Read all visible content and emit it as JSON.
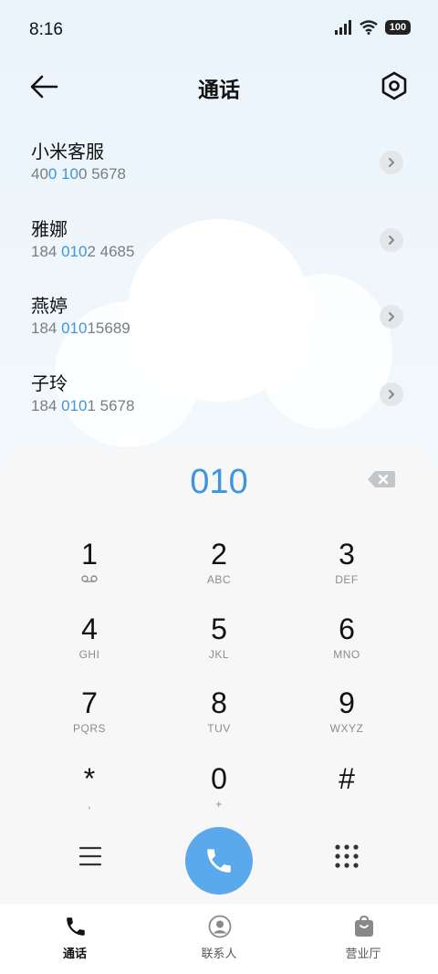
{
  "status_bar": {
    "time": "8:16",
    "battery": "100"
  },
  "header": {
    "title": "通话"
  },
  "contacts": [
    {
      "name": "小米客服",
      "number_parts": [
        "40",
        "0 10",
        "0 5678"
      ]
    },
    {
      "name": "雅娜",
      "number_parts": [
        "184 ",
        "010",
        "2 4685"
      ]
    },
    {
      "name": "燕婷",
      "number_parts": [
        "184 ",
        "010",
        "15689"
      ]
    },
    {
      "name": "子玲",
      "number_parts": [
        "184 ",
        "010",
        "1 5678"
      ]
    }
  ],
  "dialpad": {
    "input": "010",
    "keys": [
      {
        "num": "1",
        "sub": ""
      },
      {
        "num": "2",
        "sub": "ABC"
      },
      {
        "num": "3",
        "sub": "DEF"
      },
      {
        "num": "4",
        "sub": "GHI"
      },
      {
        "num": "5",
        "sub": "JKL"
      },
      {
        "num": "6",
        "sub": "MNO"
      },
      {
        "num": "7",
        "sub": "PQRS"
      },
      {
        "num": "8",
        "sub": "TUV"
      },
      {
        "num": "9",
        "sub": "WXYZ"
      },
      {
        "num": "*",
        "sub": ","
      },
      {
        "num": "0",
        "sub": "+"
      },
      {
        "num": "#",
        "sub": ""
      }
    ]
  },
  "bottom_nav": [
    {
      "label": "通话",
      "icon": "phone-icon",
      "active": true
    },
    {
      "label": "联系人",
      "icon": "person-icon",
      "active": false
    },
    {
      "label": "营业厅",
      "icon": "bag-icon",
      "active": false
    }
  ],
  "colors": {
    "accent": "#3d95e0",
    "call_button": "#5aa9ec"
  }
}
